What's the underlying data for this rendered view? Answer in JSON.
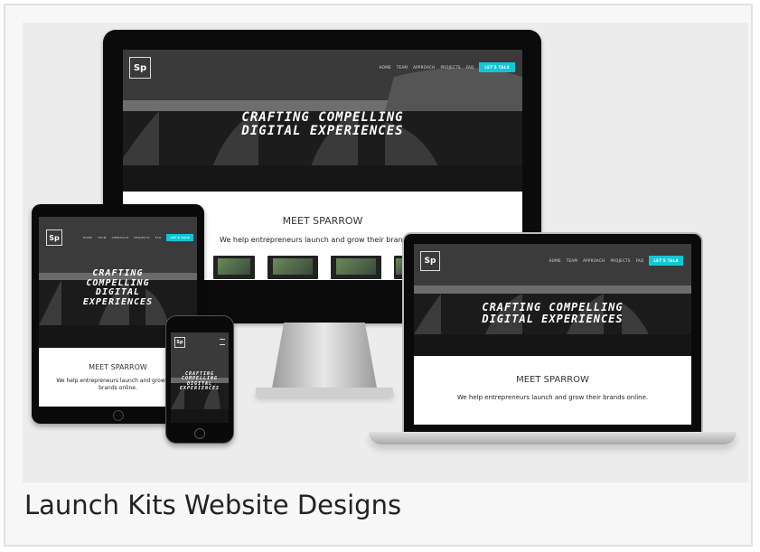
{
  "caption": "Launch Kits Website Designs",
  "site": {
    "logo": "Sp",
    "nav": [
      "HOME",
      "TEAM",
      "APPROACH",
      "PROJECTS",
      "FAQ"
    ],
    "cta": "LET'S TALK",
    "headline_line1": "CRAFTING COMPELLING",
    "headline_line2": "DIGITAL EXPERIENCES",
    "tablet_headline_1": "CRAFTING",
    "tablet_headline_2": "COMPELLING",
    "tablet_headline_3": "DIGITAL",
    "tablet_headline_4": "EXPERIENCES",
    "meet": "MEET SPARROW",
    "tagline": "We help entrepreneurs launch and grow their brands online.",
    "tagline_monitor": "We help entrepreneurs launch and grow their brands o",
    "tagline_tablet_1": "We help entrepreneurs launch and grow their",
    "tagline_tablet_2": "brands online."
  },
  "colors": {
    "accent": "#12c6d6",
    "background": "#ececec"
  }
}
